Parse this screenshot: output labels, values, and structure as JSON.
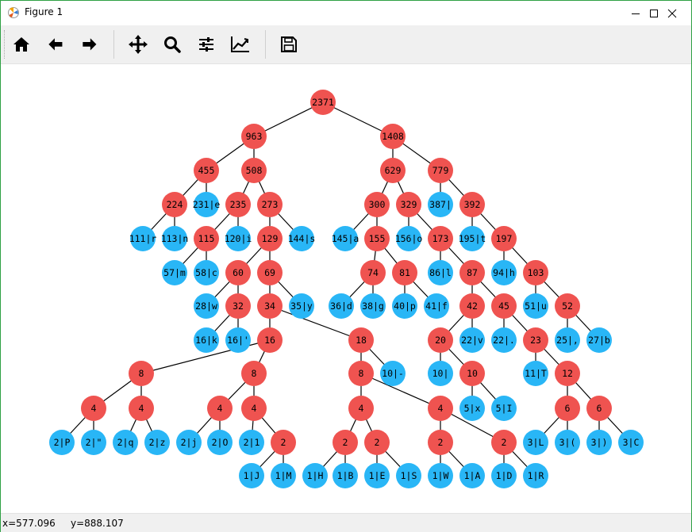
{
  "window": {
    "title": "Figure 1"
  },
  "toolbar": {
    "buttons": [
      {
        "name": "home-button",
        "icon": "home-icon"
      },
      {
        "name": "back-button",
        "icon": "arrow-left-icon"
      },
      {
        "name": "forward-button",
        "icon": "arrow-right-icon"
      },
      {
        "name": "pan-button",
        "icon": "move-icon"
      },
      {
        "name": "zoom-button",
        "icon": "magnifier-icon"
      },
      {
        "name": "subplots-button",
        "icon": "sliders-icon"
      },
      {
        "name": "axes-button",
        "icon": "chart-line-icon"
      },
      {
        "name": "save-button",
        "icon": "floppy-icon"
      }
    ]
  },
  "status": {
    "x_readout": "x=577.096",
    "y_readout": "y=888.107"
  },
  "colors": {
    "internal": "#ef5350",
    "leaf": "#29b6f6",
    "edge": "#000000"
  },
  "tree": {
    "nodes": [
      {
        "id": "r",
        "label": "2371",
        "type": "internal"
      },
      {
        "id": "n963",
        "label": "963",
        "type": "internal"
      },
      {
        "id": "n1408",
        "label": "1408",
        "type": "internal"
      },
      {
        "id": "n455",
        "label": "455",
        "type": "internal"
      },
      {
        "id": "n508",
        "label": "508",
        "type": "internal"
      },
      {
        "id": "n629",
        "label": "629",
        "type": "internal"
      },
      {
        "id": "n779",
        "label": "779",
        "type": "internal"
      },
      {
        "id": "n224",
        "label": "224",
        "type": "internal"
      },
      {
        "id": "le",
        "label": "231|e",
        "type": "leaf"
      },
      {
        "id": "n235",
        "label": "235",
        "type": "internal"
      },
      {
        "id": "n273",
        "label": "273",
        "type": "internal"
      },
      {
        "id": "n300",
        "label": "300",
        "type": "internal"
      },
      {
        "id": "n329",
        "label": "329",
        "type": "internal"
      },
      {
        "id": "lsp",
        "label": "387| ",
        "type": "leaf"
      },
      {
        "id": "n392",
        "label": "392",
        "type": "internal"
      },
      {
        "id": "lr",
        "label": "111|r",
        "type": "leaf"
      },
      {
        "id": "ln",
        "label": "113|n",
        "type": "leaf"
      },
      {
        "id": "n115",
        "label": "115",
        "type": "internal"
      },
      {
        "id": "li",
        "label": "120|i",
        "type": "leaf"
      },
      {
        "id": "n129",
        "label": "129",
        "type": "internal"
      },
      {
        "id": "ls",
        "label": "144|s",
        "type": "leaf"
      },
      {
        "id": "la",
        "label": "145|a",
        "type": "leaf"
      },
      {
        "id": "n155",
        "label": "155",
        "type": "internal"
      },
      {
        "id": "lo",
        "label": "156|o",
        "type": "leaf"
      },
      {
        "id": "n173",
        "label": "173",
        "type": "internal"
      },
      {
        "id": "lt",
        "label": "195|t",
        "type": "leaf"
      },
      {
        "id": "n197",
        "label": "197",
        "type": "internal"
      },
      {
        "id": "lm",
        "label": "57|m",
        "type": "leaf"
      },
      {
        "id": "lc",
        "label": "58|c",
        "type": "leaf"
      },
      {
        "id": "n60",
        "label": "60",
        "type": "internal"
      },
      {
        "id": "n69",
        "label": "69",
        "type": "internal"
      },
      {
        "id": "n74",
        "label": "74",
        "type": "internal"
      },
      {
        "id": "n81",
        "label": "81",
        "type": "internal"
      },
      {
        "id": "ll",
        "label": "86|l",
        "type": "leaf"
      },
      {
        "id": "n87",
        "label": "87",
        "type": "internal"
      },
      {
        "id": "lh",
        "label": "94|h",
        "type": "leaf"
      },
      {
        "id": "n103",
        "label": "103",
        "type": "internal"
      },
      {
        "id": "lw",
        "label": "28|w",
        "type": "leaf"
      },
      {
        "id": "n32",
        "label": "32",
        "type": "internal"
      },
      {
        "id": "n34",
        "label": "34",
        "type": "internal"
      },
      {
        "id": "ly",
        "label": "35|y",
        "type": "leaf"
      },
      {
        "id": "ld",
        "label": "36|d",
        "type": "leaf"
      },
      {
        "id": "lg",
        "label": "38|g",
        "type": "leaf"
      },
      {
        "id": "lp",
        "label": "40|p",
        "type": "leaf"
      },
      {
        "id": "lf",
        "label": "41|f",
        "type": "leaf"
      },
      {
        "id": "n42",
        "label": "42",
        "type": "internal"
      },
      {
        "id": "n45",
        "label": "45",
        "type": "internal"
      },
      {
        "id": "lu",
        "label": "51|u",
        "type": "leaf"
      },
      {
        "id": "n52",
        "label": "52",
        "type": "internal"
      },
      {
        "id": "lk",
        "label": "16|k",
        "type": "leaf"
      },
      {
        "id": "lq1",
        "label": "16|'",
        "type": "leaf"
      },
      {
        "id": "n16",
        "label": "16",
        "type": "internal"
      },
      {
        "id": "n18",
        "label": "18",
        "type": "internal"
      },
      {
        "id": "n20",
        "label": "20",
        "type": "internal"
      },
      {
        "id": "lv",
        "label": "22|v",
        "type": "leaf"
      },
      {
        "id": "ldot",
        "label": "22|.",
        "type": "leaf"
      },
      {
        "id": "n23",
        "label": "23",
        "type": "internal"
      },
      {
        "id": "lcomma",
        "label": "25|,",
        "type": "leaf"
      },
      {
        "id": "lb",
        "label": "27|b",
        "type": "leaf"
      },
      {
        "id": "n8a",
        "label": "8",
        "type": "internal"
      },
      {
        "id": "n8b",
        "label": "8",
        "type": "internal"
      },
      {
        "id": "n8c",
        "label": "8",
        "type": "internal"
      },
      {
        "id": "ldash",
        "label": "10|-",
        "type": "leaf"
      },
      {
        "id": "lnl",
        "label": "10|",
        "type": "leaf"
      },
      {
        "id": "n10",
        "label": "10",
        "type": "internal"
      },
      {
        "id": "lT",
        "label": "11|T",
        "type": "leaf"
      },
      {
        "id": "n12",
        "label": "12",
        "type": "internal"
      },
      {
        "id": "n4a",
        "label": "4",
        "type": "internal"
      },
      {
        "id": "n4b",
        "label": "4",
        "type": "internal"
      },
      {
        "id": "n4c",
        "label": "4",
        "type": "internal"
      },
      {
        "id": "n4d",
        "label": "4",
        "type": "internal"
      },
      {
        "id": "n4e",
        "label": "4",
        "type": "internal"
      },
      {
        "id": "n4f",
        "label": "4",
        "type": "internal"
      },
      {
        "id": "lx",
        "label": "5|x",
        "type": "leaf"
      },
      {
        "id": "lI",
        "label": "5|I",
        "type": "leaf"
      },
      {
        "id": "n6a",
        "label": "6",
        "type": "internal"
      },
      {
        "id": "n6b",
        "label": "6",
        "type": "internal"
      },
      {
        "id": "lP",
        "label": "2|P",
        "type": "leaf"
      },
      {
        "id": "lquote",
        "label": "2|\"",
        "type": "leaf"
      },
      {
        "id": "lqq",
        "label": "2|q",
        "type": "leaf"
      },
      {
        "id": "lz",
        "label": "2|z",
        "type": "leaf"
      },
      {
        "id": "lj",
        "label": "2|j",
        "type": "leaf"
      },
      {
        "id": "lO",
        "label": "2|O",
        "type": "leaf"
      },
      {
        "id": "l1",
        "label": "2|1",
        "type": "leaf"
      },
      {
        "id": "n2a",
        "label": "2",
        "type": "internal"
      },
      {
        "id": "n2b",
        "label": "2",
        "type": "internal"
      },
      {
        "id": "n2c",
        "label": "2",
        "type": "internal"
      },
      {
        "id": "n2d",
        "label": "2",
        "type": "internal"
      },
      {
        "id": "n2e",
        "label": "2",
        "type": "internal"
      },
      {
        "id": "lL",
        "label": "3|L",
        "type": "leaf"
      },
      {
        "id": "lparen",
        "label": "3|(",
        "type": "leaf"
      },
      {
        "id": "lrparen",
        "label": "3|)",
        "type": "leaf"
      },
      {
        "id": "lC",
        "label": "3|C",
        "type": "leaf"
      },
      {
        "id": "lJ",
        "label": "1|J",
        "type": "leaf"
      },
      {
        "id": "lM",
        "label": "1|M",
        "type": "leaf"
      },
      {
        "id": "lH",
        "label": "1|H",
        "type": "leaf"
      },
      {
        "id": "lB",
        "label": "1|B",
        "type": "leaf"
      },
      {
        "id": "lE",
        "label": "1|E",
        "type": "leaf"
      },
      {
        "id": "lS",
        "label": "1|S",
        "type": "leaf"
      },
      {
        "id": "lW",
        "label": "1|W",
        "type": "leaf"
      },
      {
        "id": "lA",
        "label": "1|A",
        "type": "leaf"
      },
      {
        "id": "lD",
        "label": "1|D",
        "type": "leaf"
      },
      {
        "id": "lR",
        "label": "1|R",
        "type": "leaf"
      }
    ],
    "edges": [
      [
        "r",
        "n963"
      ],
      [
        "r",
        "n1408"
      ],
      [
        "n963",
        "n455"
      ],
      [
        "n963",
        "n508"
      ],
      [
        "n1408",
        "n629"
      ],
      [
        "n1408",
        "n779"
      ],
      [
        "n455",
        "n224"
      ],
      [
        "n455",
        "le"
      ],
      [
        "n508",
        "n235"
      ],
      [
        "n508",
        "n273"
      ],
      [
        "n629",
        "n300"
      ],
      [
        "n629",
        "n329"
      ],
      [
        "n779",
        "lsp"
      ],
      [
        "n779",
        "n392"
      ],
      [
        "n224",
        "lr"
      ],
      [
        "n224",
        "ln"
      ],
      [
        "n235",
        "n115"
      ],
      [
        "n235",
        "li"
      ],
      [
        "n273",
        "n129"
      ],
      [
        "n273",
        "ls"
      ],
      [
        "n300",
        "la"
      ],
      [
        "n300",
        "n155"
      ],
      [
        "n329",
        "lo"
      ],
      [
        "n329",
        "n173"
      ],
      [
        "n392",
        "lt"
      ],
      [
        "n392",
        "n197"
      ],
      [
        "n115",
        "lm"
      ],
      [
        "n115",
        "lc"
      ],
      [
        "n129",
        "n60"
      ],
      [
        "n129",
        "n69"
      ],
      [
        "n155",
        "n74"
      ],
      [
        "n155",
        "n81"
      ],
      [
        "n173",
        "ll"
      ],
      [
        "n173",
        "n87"
      ],
      [
        "n197",
        "lh"
      ],
      [
        "n197",
        "n103"
      ],
      [
        "n60",
        "lw"
      ],
      [
        "n60",
        "n32"
      ],
      [
        "n69",
        "n34"
      ],
      [
        "n69",
        "ly"
      ],
      [
        "n74",
        "ld"
      ],
      [
        "n74",
        "lg"
      ],
      [
        "n81",
        "lp"
      ],
      [
        "n81",
        "lf"
      ],
      [
        "n87",
        "n42"
      ],
      [
        "n87",
        "n45"
      ],
      [
        "n103",
        "lu"
      ],
      [
        "n103",
        "n52"
      ],
      [
        "n32",
        "lk"
      ],
      [
        "n32",
        "lq1"
      ],
      [
        "n34",
        "n16"
      ],
      [
        "n34",
        "n18"
      ],
      [
        "n42",
        "n20"
      ],
      [
        "n42",
        "lv"
      ],
      [
        "n45",
        "ldot"
      ],
      [
        "n45",
        "n23"
      ],
      [
        "n52",
        "lcomma"
      ],
      [
        "n52",
        "lb"
      ],
      [
        "n16",
        "n8a"
      ],
      [
        "n16",
        "n8b"
      ],
      [
        "n18",
        "n8c"
      ],
      [
        "n18",
        "ldash"
      ],
      [
        "n20",
        "lnl"
      ],
      [
        "n20",
        "n10"
      ],
      [
        "n23",
        "lT"
      ],
      [
        "n23",
        "n12"
      ],
      [
        "n8a",
        "n4a"
      ],
      [
        "n8a",
        "n4b"
      ],
      [
        "n8b",
        "n4c"
      ],
      [
        "n8b",
        "n4d"
      ],
      [
        "n8c",
        "n4e"
      ],
      [
        "n8c",
        "n4f"
      ],
      [
        "n10",
        "lx"
      ],
      [
        "n10",
        "lI"
      ],
      [
        "n12",
        "n6a"
      ],
      [
        "n12",
        "n6b"
      ],
      [
        "n4a",
        "lP"
      ],
      [
        "n4a",
        "lquote"
      ],
      [
        "n4b",
        "lqq"
      ],
      [
        "n4b",
        "lz"
      ],
      [
        "n4c",
        "lj"
      ],
      [
        "n4c",
        "lO"
      ],
      [
        "n4d",
        "l1"
      ],
      [
        "n4d",
        "n2a"
      ],
      [
        "n4e",
        "n2b"
      ],
      [
        "n4e",
        "n2c"
      ],
      [
        "n4f",
        "n2d"
      ],
      [
        "n4f",
        "n2e"
      ],
      [
        "n6a",
        "lL"
      ],
      [
        "n6a",
        "lparen"
      ],
      [
        "n6b",
        "lrparen"
      ],
      [
        "n6b",
        "lC"
      ],
      [
        "n2a",
        "lJ"
      ],
      [
        "n2a",
        "lM"
      ],
      [
        "n2b",
        "lH"
      ],
      [
        "n2b",
        "lB"
      ],
      [
        "n2c",
        "lE"
      ],
      [
        "n2c",
        "lS"
      ],
      [
        "n2d",
        "lW"
      ],
      [
        "n2d",
        "lA"
      ],
      [
        "n2e",
        "lD"
      ],
      [
        "n2e",
        "lR"
      ]
    ]
  }
}
